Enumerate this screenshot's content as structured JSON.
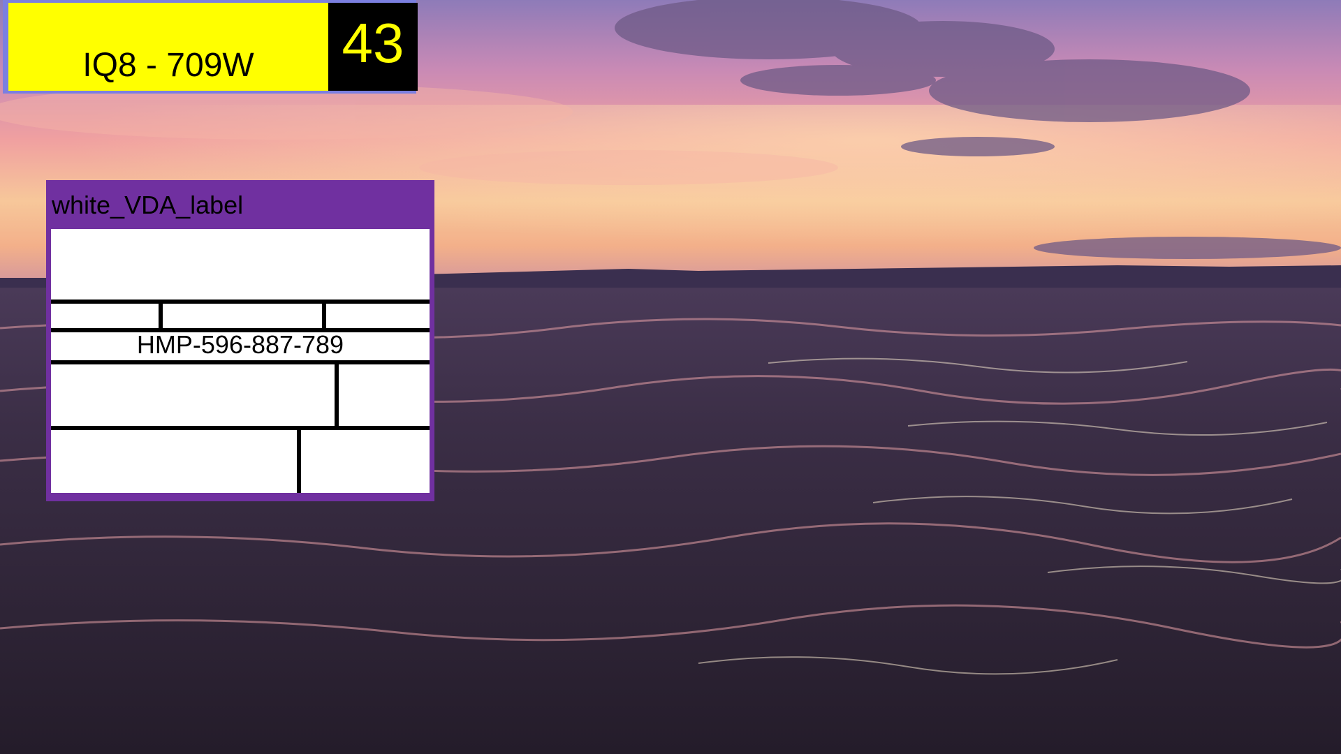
{
  "header": {
    "code_label": "IQ8 - 709W",
    "count": "43",
    "colors": {
      "border": "#7b7fe0",
      "label_bg": "#ffff00",
      "count_bg": "#000000",
      "count_text": "#ffff00"
    }
  },
  "label_card": {
    "title": "white_VDA_label",
    "code": "HMP-596-887-789",
    "colors": {
      "frame": "#7030a0",
      "body": "#ffffff",
      "lines": "#000000"
    }
  },
  "background": {
    "description_icon": "sunset-sea-icon"
  }
}
